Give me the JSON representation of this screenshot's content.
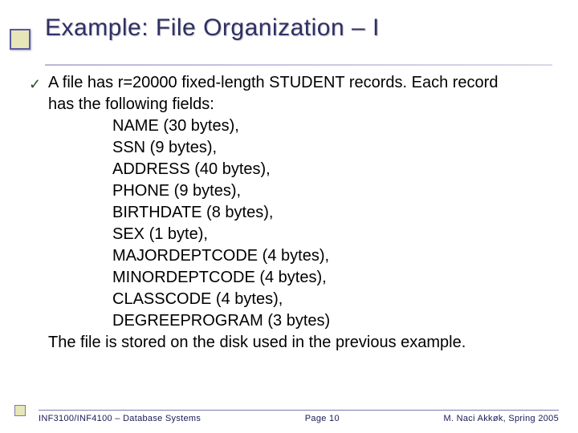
{
  "title": "Example: File Organization – I",
  "bullet": {
    "lead_a": "A file has r=20000 fixed-length STUDENT records. Each record",
    "lead_b": "has the following fields:",
    "fields": [
      "NAME (30 bytes),",
      "SSN (9 bytes),",
      "ADDRESS (40 bytes),",
      "PHONE (9 bytes),",
      "BIRTHDATE (8 bytes),",
      "SEX (1 byte),",
      "MAJORDEPTCODE (4 bytes),",
      "MINORDEPTCODE (4 bytes),",
      "CLASSCODE (4 bytes),",
      "DEGREEPROGRAM (3 bytes)"
    ],
    "tail": "The file is stored on the disk used in the previous example."
  },
  "footer": {
    "left": "INF3100/INF4100 – Database Systems",
    "center": "Page 10",
    "right": "M. Naci Akkøk, Spring 2005"
  }
}
